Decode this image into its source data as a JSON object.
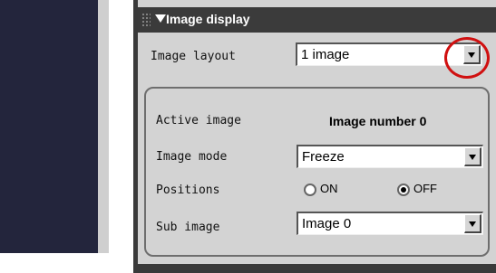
{
  "panel": {
    "title": "Image display"
  },
  "image_layout": {
    "label": "Image layout",
    "value": "1 image"
  },
  "active_image": {
    "label": "Active image",
    "value": "Image number 0"
  },
  "image_mode": {
    "label": "Image mode",
    "value": "Freeze"
  },
  "positions": {
    "label": "Positions",
    "on_label": "ON",
    "off_label": "OFF",
    "selected": "OFF"
  },
  "sub_image": {
    "label": "Sub image",
    "value": "Image 0"
  },
  "colors": {
    "highlight": "#d01010",
    "panel_header": "#3b3b3b",
    "panel_background": "#d3d3d3"
  }
}
